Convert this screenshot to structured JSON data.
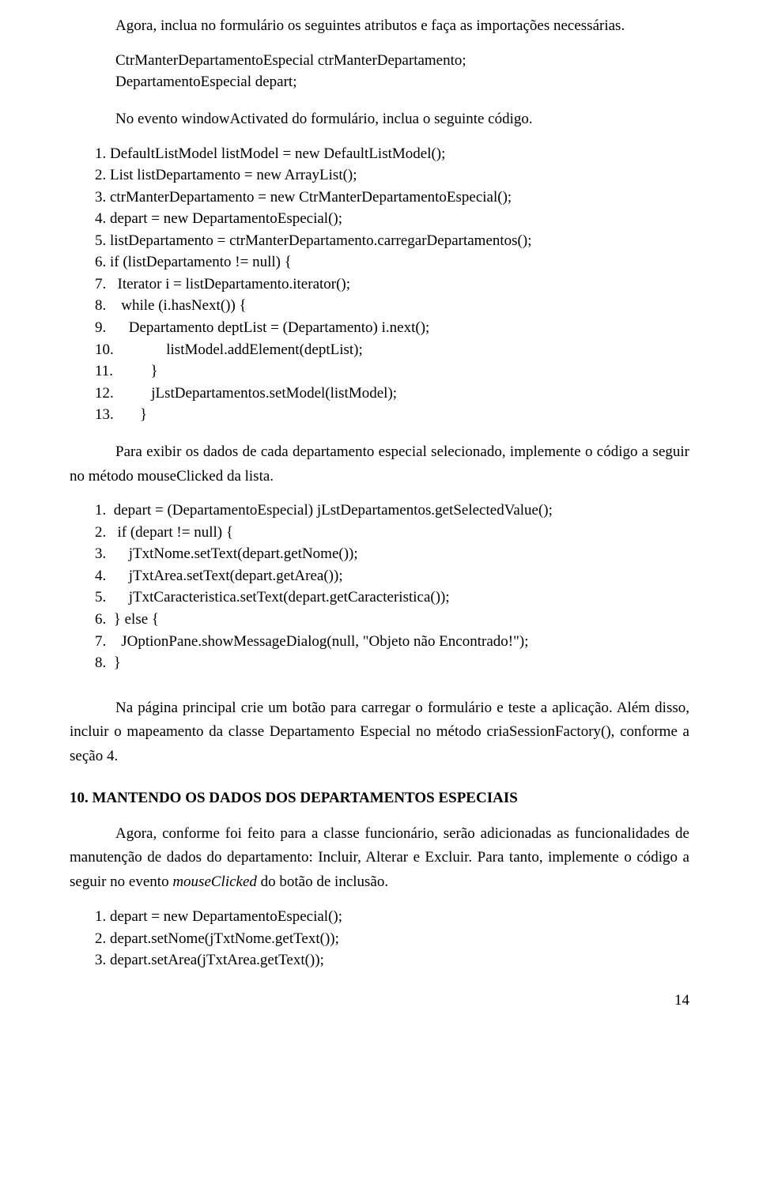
{
  "p1": "Agora, inclua no formulário os seguintes atributos e faça as importações necessárias.",
  "decl1_lines": [
    "CtrManterDepartamentoEspecial ctrManterDepartamento;",
    "DepartamentoEspecial depart;"
  ],
  "p2": "No evento windowActivated do formulário, inclua o seguinte código.",
  "code1_lines": [
    "1. DefaultListModel listModel = new DefaultListModel();",
    "2. List listDepartamento = new ArrayList();",
    "3. ctrManterDepartamento = new CtrManterDepartamentoEspecial();",
    "4. depart = new DepartamentoEspecial();",
    "5. listDepartamento = ctrManterDepartamento.carregarDepartamentos();",
    "6. if (listDepartamento != null) {",
    "7.   Iterator i = listDepartamento.iterator();",
    "8.    while (i.hasNext()) {",
    "9.      Departamento deptList = (Departamento) i.next();",
    "10.              listModel.addElement(deptList);",
    "11.          }",
    "12.          jLstDepartamentos.setModel(listModel);",
    "13.       }"
  ],
  "p3": "Para exibir os dados de cada departamento especial selecionado, implemente o código a seguir no método mouseClicked da lista.",
  "code2_lines": [
    "1.  depart = (DepartamentoEspecial) jLstDepartamentos.getSelectedValue();",
    "2.   if (depart != null) {",
    "3.      jTxtNome.setText(depart.getNome());",
    "4.      jTxtArea.setText(depart.getArea());",
    "5.      jTxtCaracteristica.setText(depart.getCaracteristica());",
    "6.  } else {",
    "7.    JOptionPane.showMessageDialog(null, \"Objeto não Encontrado!\");",
    "8.  }"
  ],
  "p4": "Na página principal crie um botão para carregar o formulário e teste a aplicação. Além disso, incluir o mapeamento da classe Departamento Especial no método criaSessionFactory(), conforme a seção 4.",
  "heading": "10. MANTENDO OS DADOS DOS DEPARTAMENTOS ESPECIAIS",
  "p5_a": "Agora, conforme foi feito para a classe funcionário, serão adicionadas as funcionalidades de manutenção de dados do departamento: Incluir, Alterar e Excluir. Para tanto, implemente o código a seguir no evento ",
  "p5_b": "mouseClicked",
  "p5_c": " do botão de inclusão.",
  "code3_lines": [
    "1. depart = new DepartamentoEspecial();",
    "2. depart.setNome(jTxtNome.getText());",
    "3. depart.setArea(jTxtArea.getText());"
  ],
  "pagenum": "14"
}
